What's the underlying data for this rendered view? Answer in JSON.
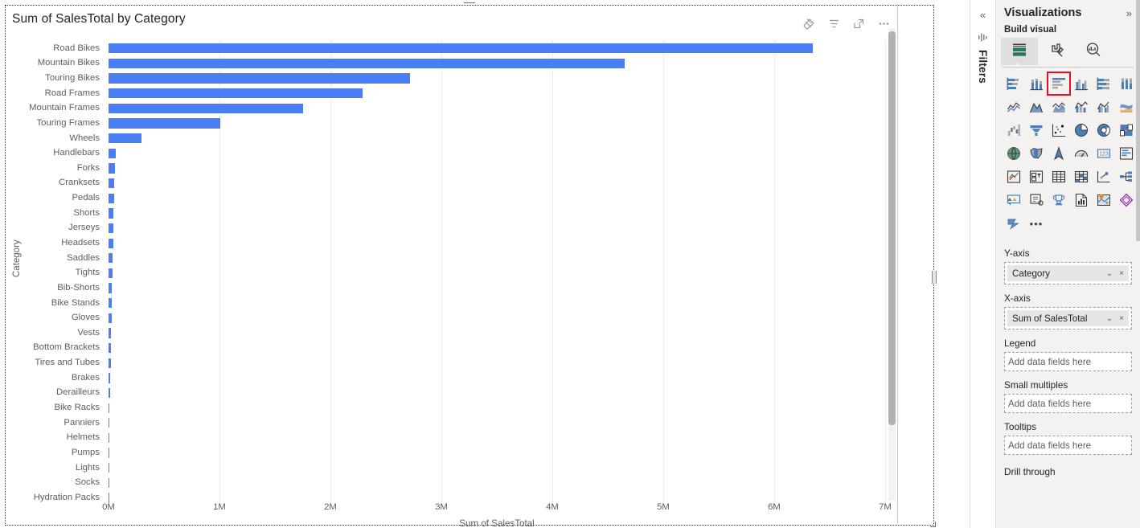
{
  "visual": {
    "title": "Sum of SalesTotal by Category",
    "header_icons": [
      {
        "name": "pin-icon",
        "label": "Pin"
      },
      {
        "name": "filter-icon",
        "label": "Filters"
      },
      {
        "name": "focus-mode-icon",
        "label": "Focus mode"
      },
      {
        "name": "more-options-icon",
        "label": "More options"
      }
    ]
  },
  "chart_data": {
    "type": "bar",
    "orientation": "horizontal",
    "title": "Sum of SalesTotal by Category",
    "xlabel": "Sum of SalesTotal",
    "ylabel": "Category",
    "xlim": [
      0,
      7000000
    ],
    "xticks": [
      "0M",
      "1M",
      "2M",
      "3M",
      "4M",
      "5M",
      "6M",
      "7M"
    ],
    "xtick_values": [
      0,
      1000000,
      2000000,
      3000000,
      4000000,
      5000000,
      6000000,
      7000000
    ],
    "grid": true,
    "legend": "none",
    "bar_color": "#4a7ef7",
    "categories": [
      "Road Bikes",
      "Mountain Bikes",
      "Touring Bikes",
      "Road Frames",
      "Mountain Frames",
      "Touring Frames",
      "Wheels",
      "Handlebars",
      "Forks",
      "Cranksets",
      "Pedals",
      "Shorts",
      "Jerseys",
      "Headsets",
      "Saddles",
      "Tights",
      "Bib-Shorts",
      "Bike Stands",
      "Gloves",
      "Vests",
      "Bottom Brackets",
      "Tires and Tubes",
      "Brakes",
      "Derailleurs",
      "Bike Racks",
      "Panniers",
      "Helmets",
      "Pumps",
      "Lights",
      "Socks",
      "Hydration Packs"
    ],
    "values": [
      6350000,
      4650000,
      2720000,
      2290000,
      1755000,
      1010000,
      300000,
      62000,
      58000,
      54000,
      50000,
      47000,
      44000,
      41000,
      38000,
      35000,
      32000,
      29000,
      26000,
      23000,
      21000,
      19000,
      15000,
      12000,
      10000,
      8000,
      7000,
      6000,
      5000,
      4500,
      4000
    ]
  },
  "filters_rail": {
    "collapse_label": "«",
    "title": "Filters"
  },
  "viz_pane": {
    "title": "Visualizations",
    "expand_label": "»",
    "subtitle": "Build visual",
    "build_tabs": [
      {
        "name": "build-visual-tab",
        "icon": "table-fields-icon",
        "active": true
      },
      {
        "name": "format-visual-tab",
        "icon": "paint-brush-icon",
        "active": false
      },
      {
        "name": "analytics-tab",
        "icon": "magnifier-chart-icon",
        "active": false
      }
    ],
    "gallery": [
      {
        "name": "stacked-bar-chart",
        "selected": false
      },
      {
        "name": "stacked-column-chart",
        "selected": false
      },
      {
        "name": "clustered-bar-chart",
        "selected": true
      },
      {
        "name": "clustered-column-chart",
        "selected": false
      },
      {
        "name": "100-stacked-bar-chart",
        "selected": false
      },
      {
        "name": "100-stacked-column-chart",
        "selected": false
      },
      {
        "name": "line-chart",
        "selected": false
      },
      {
        "name": "area-chart",
        "selected": false
      },
      {
        "name": "stacked-area-chart",
        "selected": false
      },
      {
        "name": "line-and-stacked-column-chart",
        "selected": false
      },
      {
        "name": "line-and-clustered-column-chart",
        "selected": false
      },
      {
        "name": "ribbon-chart",
        "selected": false
      },
      {
        "name": "waterfall-chart",
        "selected": false
      },
      {
        "name": "funnel-chart",
        "selected": false
      },
      {
        "name": "scatter-chart",
        "selected": false
      },
      {
        "name": "pie-chart",
        "selected": false
      },
      {
        "name": "donut-chart",
        "selected": false
      },
      {
        "name": "treemap-chart",
        "selected": false
      },
      {
        "name": "map-chart",
        "selected": false
      },
      {
        "name": "filled-map-chart",
        "selected": false
      },
      {
        "name": "azure-map-chart",
        "selected": false
      },
      {
        "name": "gauge-chart",
        "selected": false
      },
      {
        "name": "card-visual",
        "selected": false
      },
      {
        "name": "multi-row-card-visual",
        "selected": false
      },
      {
        "name": "kpi-visual",
        "selected": false
      },
      {
        "name": "slicer-visual",
        "selected": false
      },
      {
        "name": "table-visual",
        "selected": false
      },
      {
        "name": "matrix-visual",
        "selected": false
      },
      {
        "name": "scatter-play-axis-visual",
        "selected": false
      },
      {
        "name": "decomposition-tree-visual",
        "selected": false
      },
      {
        "name": "key-influencers-visual",
        "selected": false
      },
      {
        "name": "narrative-visual",
        "selected": false
      },
      {
        "name": "metrics-visual",
        "selected": false
      },
      {
        "name": "paginated-report-visual",
        "selected": false
      },
      {
        "name": "arcgis-map-visual",
        "selected": false
      },
      {
        "name": "powerapps-visual",
        "selected": false
      },
      {
        "name": "power-automate-visual",
        "selected": false
      },
      {
        "name": "more-visuals",
        "selected": false
      }
    ],
    "wells": [
      {
        "name": "y-axis-well",
        "label": "Y-axis",
        "field": "Category",
        "placeholder": null,
        "chip_menu": "⌄",
        "chip_remove": "×"
      },
      {
        "name": "x-axis-well",
        "label": "X-axis",
        "field": "Sum of SalesTotal",
        "placeholder": null,
        "chip_menu": "⌄",
        "chip_remove": "×"
      },
      {
        "name": "legend-well",
        "label": "Legend",
        "field": null,
        "placeholder": "Add data fields here"
      },
      {
        "name": "small-multiples-well",
        "label": "Small multiples",
        "field": null,
        "placeholder": "Add data fields here"
      },
      {
        "name": "tooltips-well",
        "label": "Tooltips",
        "field": null,
        "placeholder": "Add data fields here"
      }
    ],
    "drill_through_label": "Drill through"
  }
}
